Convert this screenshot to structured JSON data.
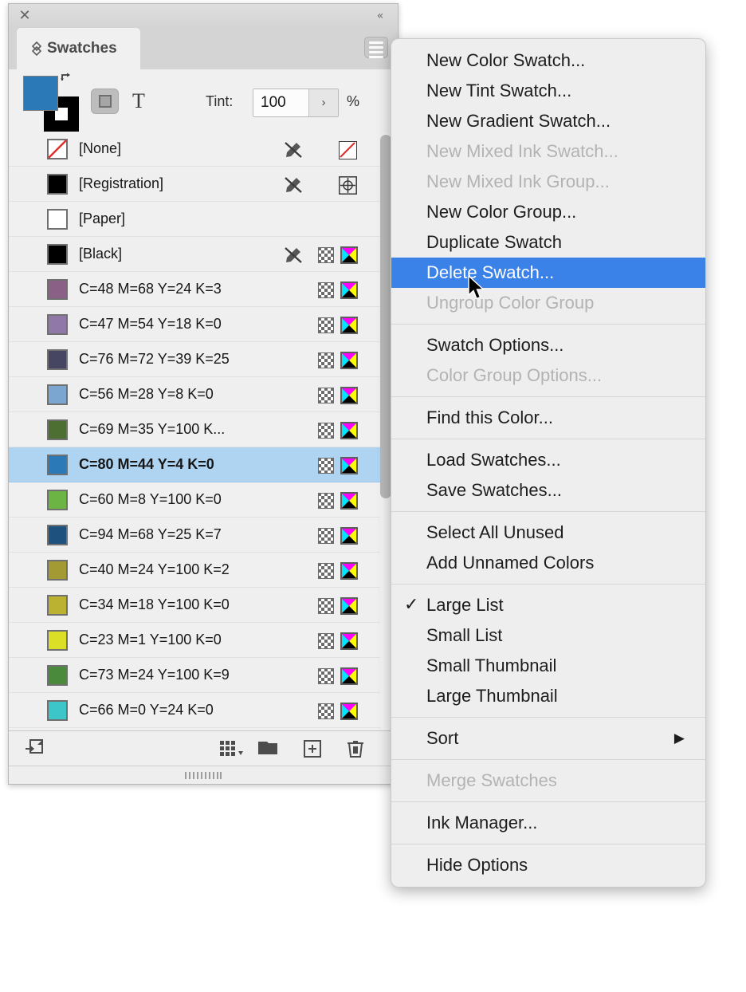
{
  "panel": {
    "title": "Swatches",
    "close_icon": "close-icon",
    "collapse_icon": "collapse-double-chevron-icon",
    "menu_icon": "panel-menu-hamburger-icon",
    "options": {
      "fill_color": "#2C79B8",
      "stroke_color": "#000000",
      "container_button_label": "formatting-affects-container",
      "text_button_label": "T",
      "tint_label": "Tint:",
      "tint_value": "100",
      "tint_arrow": "›",
      "tint_percent": "%"
    },
    "footer": {
      "show_swatches_icon": "show-swatches-in-group-icon",
      "new_color_group_icon": "new-color-group-icon",
      "color_group_folder_icon": "color-group-folder-icon",
      "new_swatch_icon": "new-swatch-plus-icon",
      "delete_swatch_icon": "delete-swatch-trash-icon"
    }
  },
  "swatches": [
    {
      "name": "[None]",
      "color": "none",
      "pencil": true,
      "checker": false,
      "mark": "none"
    },
    {
      "name": "[Registration]",
      "color": "#000000",
      "pencil": true,
      "checker": false,
      "mark": "registration"
    },
    {
      "name": "[Paper]",
      "color": "#ffffff",
      "pencil": false,
      "checker": false,
      "mark": "empty"
    },
    {
      "name": "[Black]",
      "color": "#000000",
      "pencil": true,
      "checker": true,
      "mark": "cmyk"
    },
    {
      "name": "C=48 M=68 Y=24 K=3",
      "color": "#8a6087",
      "pencil": false,
      "checker": true,
      "mark": "cmyk"
    },
    {
      "name": "C=47 M=54 Y=18 K=0",
      "color": "#9079a8",
      "pencil": false,
      "checker": true,
      "mark": "cmyk"
    },
    {
      "name": "C=76 M=72 Y=39 K=25",
      "color": "#474662",
      "pencil": false,
      "checker": true,
      "mark": "cmyk"
    },
    {
      "name": "C=56 M=28 Y=8 K=0",
      "color": "#7ba6d0",
      "pencil": false,
      "checker": true,
      "mark": "cmyk"
    },
    {
      "name": "C=69 M=35 Y=100 K...",
      "color": "#4d7032",
      "pencil": false,
      "checker": true,
      "mark": "cmyk"
    },
    {
      "name": "C=80 M=44 Y=4 K=0",
      "color": "#2c79b8",
      "pencil": false,
      "checker": true,
      "mark": "cmyk",
      "selected": true
    },
    {
      "name": "C=60 M=8 Y=100 K=0",
      "color": "#6cb544",
      "pencil": false,
      "checker": true,
      "mark": "cmyk"
    },
    {
      "name": "C=94 M=68 Y=25 K=7",
      "color": "#1f517e",
      "pencil": false,
      "checker": true,
      "mark": "cmyk"
    },
    {
      "name": "C=40 M=24 Y=100 K=2",
      "color": "#a49a34",
      "pencil": false,
      "checker": true,
      "mark": "cmyk"
    },
    {
      "name": "C=34 M=18 Y=100 K=0",
      "color": "#bbb231",
      "pencil": false,
      "checker": true,
      "mark": "cmyk"
    },
    {
      "name": "C=23 M=1 Y=100 K=0",
      "color": "#dbdf26",
      "pencil": false,
      "checker": true,
      "mark": "cmyk"
    },
    {
      "name": "C=73 M=24 Y=100 K=9",
      "color": "#4a8a3c",
      "pencil": false,
      "checker": true,
      "mark": "cmyk"
    },
    {
      "name": "C=66 M=0 Y=24 K=0",
      "color": "#3cc6c9",
      "pencil": false,
      "checker": true,
      "mark": "cmyk"
    }
  ],
  "menu": {
    "highlight_color": "#3b82e8",
    "items": [
      {
        "label": "New Color Swatch...",
        "type": "item",
        "state": "enabled"
      },
      {
        "label": "New Tint Swatch...",
        "type": "item",
        "state": "enabled"
      },
      {
        "label": "New Gradient Swatch...",
        "type": "item",
        "state": "enabled"
      },
      {
        "label": "New Mixed Ink Swatch...",
        "type": "item",
        "state": "disabled"
      },
      {
        "label": "New Mixed Ink Group...",
        "type": "item",
        "state": "disabled"
      },
      {
        "label": "New Color Group...",
        "type": "item",
        "state": "enabled"
      },
      {
        "label": "Duplicate Swatch",
        "type": "item",
        "state": "enabled"
      },
      {
        "label": "Delete Swatch...",
        "type": "item",
        "state": "highlighted"
      },
      {
        "label": "Ungroup Color Group",
        "type": "item",
        "state": "disabled"
      },
      {
        "label": "",
        "type": "separator",
        "state": ""
      },
      {
        "label": "Swatch Options...",
        "type": "item",
        "state": "enabled"
      },
      {
        "label": "Color Group Options...",
        "type": "item",
        "state": "disabled"
      },
      {
        "label": "",
        "type": "separator",
        "state": ""
      },
      {
        "label": "Find this Color...",
        "type": "item",
        "state": "enabled"
      },
      {
        "label": "",
        "type": "separator",
        "state": ""
      },
      {
        "label": "Load Swatches...",
        "type": "item",
        "state": "enabled"
      },
      {
        "label": "Save Swatches...",
        "type": "item",
        "state": "enabled"
      },
      {
        "label": "",
        "type": "separator",
        "state": ""
      },
      {
        "label": "Select All Unused",
        "type": "item",
        "state": "enabled"
      },
      {
        "label": "Add Unnamed Colors",
        "type": "item",
        "state": "enabled"
      },
      {
        "label": "",
        "type": "separator",
        "state": ""
      },
      {
        "label": "Large List",
        "type": "item",
        "state": "enabled",
        "checked": true
      },
      {
        "label": "Small List",
        "type": "item",
        "state": "enabled"
      },
      {
        "label": "Small Thumbnail",
        "type": "item",
        "state": "enabled"
      },
      {
        "label": "Large Thumbnail",
        "type": "item",
        "state": "enabled"
      },
      {
        "label": "",
        "type": "separator",
        "state": ""
      },
      {
        "label": "Sort",
        "type": "item",
        "state": "enabled",
        "submenu": true
      },
      {
        "label": "",
        "type": "separator",
        "state": ""
      },
      {
        "label": "Merge Swatches",
        "type": "item",
        "state": "disabled"
      },
      {
        "label": "",
        "type": "separator",
        "state": ""
      },
      {
        "label": "Ink Manager...",
        "type": "item",
        "state": "enabled"
      },
      {
        "label": "",
        "type": "separator",
        "state": ""
      },
      {
        "label": "Hide Options",
        "type": "item",
        "state": "enabled"
      }
    ],
    "check_glyph": "✓",
    "submenu_glyph": "▶"
  },
  "cursor": {
    "icon": "mouse-pointer-arrow"
  }
}
